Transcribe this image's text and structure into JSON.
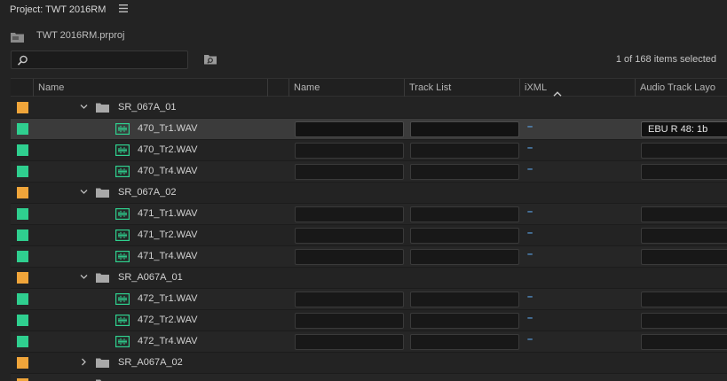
{
  "panel": {
    "title": "Project: TWT 2016RM",
    "project_file": "TWT 2016RM.prproj",
    "search_value": "",
    "selection_count": "1 of 168 items selected"
  },
  "colors": {
    "label_orange": "#f0a53a",
    "label_green": "#2fcf8f",
    "audio_icon_green": "#2fd18f",
    "link_blue": "#5ba3e6"
  },
  "columns": [
    {
      "label": ""
    },
    {
      "label": "Name"
    },
    {
      "label": ""
    },
    {
      "label": "Name"
    },
    {
      "label": "Track List"
    },
    {
      "label": "iXML"
    },
    {
      "label": "Audio Track Layo"
    }
  ],
  "ixml_sort": "ascending",
  "rows": [
    {
      "type": "bin",
      "name": "SR_067A_01",
      "label": "orange",
      "expanded": true
    },
    {
      "type": "clip",
      "name": "470_Tr1.WAV",
      "label": "green",
      "selected": true,
      "ixml": "–",
      "layout": "EBU R 48: 1b"
    },
    {
      "type": "clip",
      "name": "470_Tr2.WAV",
      "label": "green",
      "ixml": "–",
      "layout": ""
    },
    {
      "type": "clip",
      "name": "470_Tr4.WAV",
      "label": "green",
      "ixml": "–",
      "layout": ""
    },
    {
      "type": "bin",
      "name": "SR_067A_02",
      "label": "orange",
      "expanded": true
    },
    {
      "type": "clip",
      "name": "471_Tr1.WAV",
      "label": "green",
      "ixml": "–",
      "layout": ""
    },
    {
      "type": "clip",
      "name": "471_Tr2.WAV",
      "label": "green",
      "ixml": "–",
      "layout": ""
    },
    {
      "type": "clip",
      "name": "471_Tr4.WAV",
      "label": "green",
      "ixml": "–",
      "layout": ""
    },
    {
      "type": "bin",
      "name": "SR_A067A_01",
      "label": "orange",
      "expanded": true
    },
    {
      "type": "clip",
      "name": "472_Tr1.WAV",
      "label": "green",
      "ixml": "–",
      "layout": ""
    },
    {
      "type": "clip",
      "name": "472_Tr2.WAV",
      "label": "green",
      "ixml": "–",
      "layout": ""
    },
    {
      "type": "clip",
      "name": "472_Tr4.WAV",
      "label": "green",
      "ixml": "–",
      "layout": ""
    },
    {
      "type": "bin",
      "name": "SR_A067A_02",
      "label": "orange",
      "expanded": false
    },
    {
      "type": "bin",
      "name": "",
      "label": "orange",
      "expanded": true
    }
  ]
}
